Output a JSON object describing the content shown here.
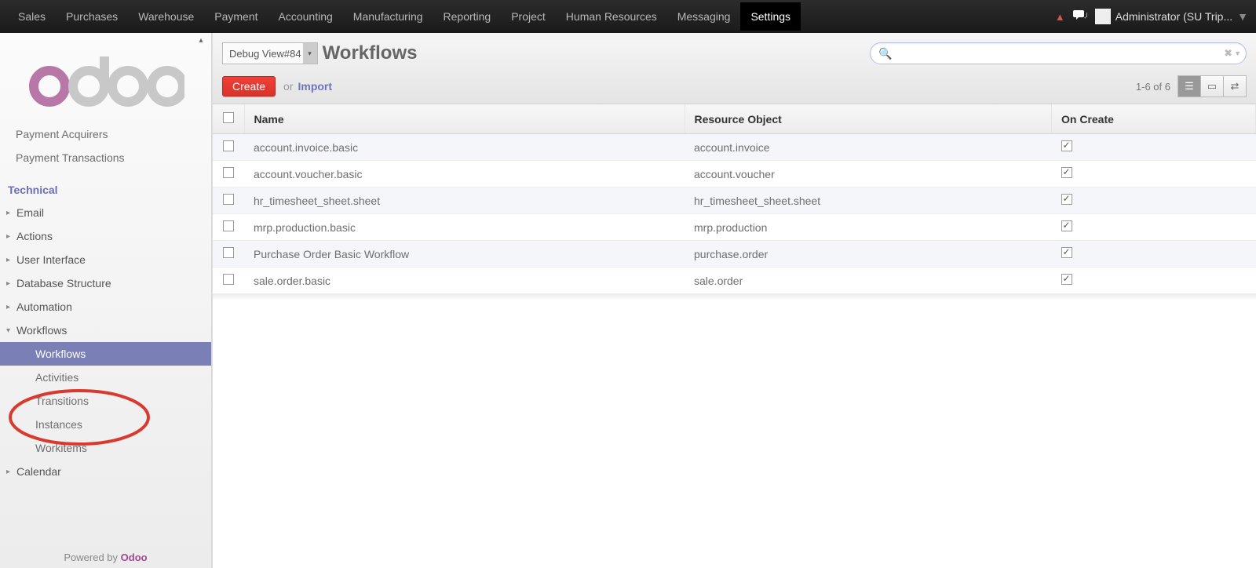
{
  "topnav": {
    "items": [
      "Sales",
      "Purchases",
      "Warehouse",
      "Payment",
      "Accounting",
      "Manufacturing",
      "Reporting",
      "Project",
      "Human Resources",
      "Messaging",
      "Settings"
    ],
    "active_index": 10,
    "user_label": "Administrator (SU Trip..."
  },
  "sidebar": {
    "top_items": [
      "Payment Acquirers",
      "Payment Transactions"
    ],
    "heading": "Technical",
    "groups": [
      {
        "label": "Email",
        "expanded": false
      },
      {
        "label": "Actions",
        "expanded": false
      },
      {
        "label": "User Interface",
        "expanded": false
      },
      {
        "label": "Database Structure",
        "expanded": false
      },
      {
        "label": "Automation",
        "expanded": false
      },
      {
        "label": "Workflows",
        "expanded": true,
        "children": [
          "Workflows",
          "Activities",
          "Transitions",
          "Instances",
          "Workitems"
        ],
        "active_child": 0
      },
      {
        "label": "Calendar",
        "expanded": false
      }
    ],
    "powered_prefix": "Powered by ",
    "powered_brand": "Odoo"
  },
  "header": {
    "debug_view": "Debug View#84",
    "title": "Workflows",
    "search_placeholder": "",
    "create_label": "Create",
    "or_label": "or",
    "import_label": "Import",
    "pager": "1-6 of 6"
  },
  "table": {
    "columns": [
      "Name",
      "Resource Object",
      "On Create"
    ],
    "rows": [
      {
        "name": "account.invoice.basic",
        "resource": "account.invoice",
        "on_create": true
      },
      {
        "name": "account.voucher.basic",
        "resource": "account.voucher",
        "on_create": true
      },
      {
        "name": "hr_timesheet_sheet.sheet",
        "resource": "hr_timesheet_sheet.sheet",
        "on_create": true
      },
      {
        "name": "mrp.production.basic",
        "resource": "mrp.production",
        "on_create": true
      },
      {
        "name": "Purchase Order Basic Workflow",
        "resource": "purchase.order",
        "on_create": true
      },
      {
        "name": "sale.order.basic",
        "resource": "sale.order",
        "on_create": true
      }
    ]
  }
}
